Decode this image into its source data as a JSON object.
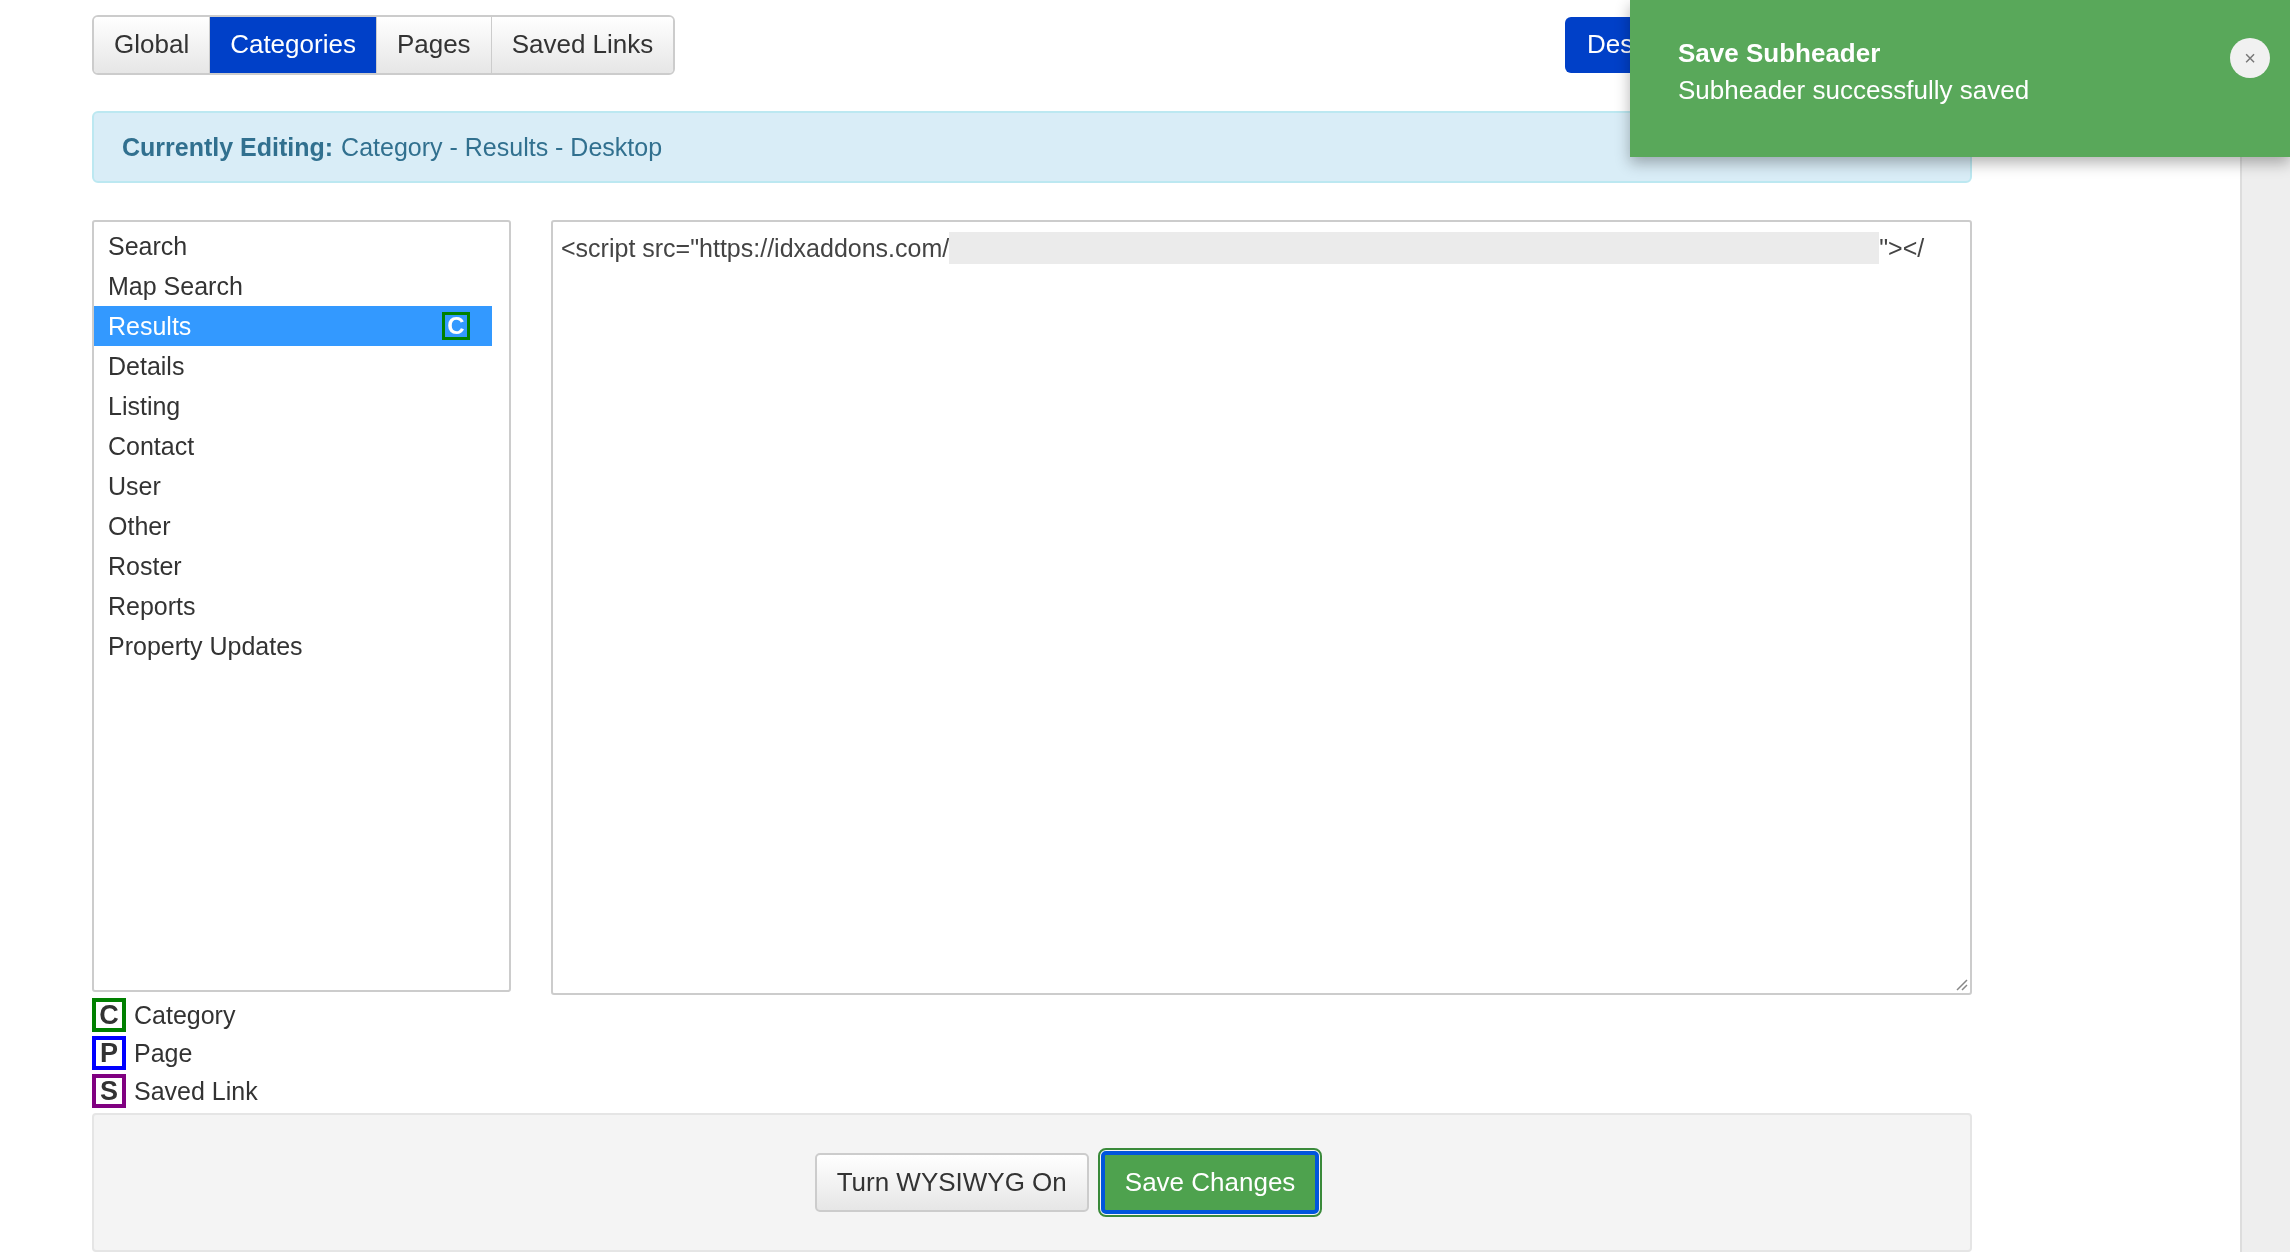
{
  "tabs": [
    {
      "label": "Global",
      "selected": false
    },
    {
      "label": "Categories",
      "selected": true
    },
    {
      "label": "Pages",
      "selected": false
    },
    {
      "label": "Saved Links",
      "selected": false
    }
  ],
  "device_button": {
    "label": "Des"
  },
  "editing_bar": {
    "label": "Currently Editing:",
    "value": "Category - Results - Desktop"
  },
  "sections": [
    {
      "label": "Search",
      "selected": false
    },
    {
      "label": "Map Search",
      "selected": false
    },
    {
      "label": "Results",
      "selected": true,
      "badge": {
        "letter": "C",
        "color": "#008000"
      }
    },
    {
      "label": "Details",
      "selected": false
    },
    {
      "label": "Listing",
      "selected": false
    },
    {
      "label": "Contact",
      "selected": false
    },
    {
      "label": "User",
      "selected": false
    },
    {
      "label": "Other",
      "selected": false
    },
    {
      "label": "Roster",
      "selected": false
    },
    {
      "label": "Reports",
      "selected": false
    },
    {
      "label": "Property Updates",
      "selected": false
    }
  ],
  "editor": {
    "code_start": "<script src=\"https://idxaddons.com/",
    "code_end": "\"></"
  },
  "legend": [
    {
      "letter": "C",
      "label": "Category",
      "color": "#008000"
    },
    {
      "letter": "P",
      "label": "Page",
      "color": "#0000ff"
    },
    {
      "letter": "S",
      "label": "Saved Link",
      "color": "#800080"
    }
  ],
  "buttons": [
    {
      "label": "Turn WYSIWYG On",
      "kind": "default"
    },
    {
      "label": "Save Changes",
      "kind": "primary"
    }
  ],
  "toast": {
    "title": "Save Subheader",
    "message": "Subheader successfully saved",
    "close": "×"
  }
}
